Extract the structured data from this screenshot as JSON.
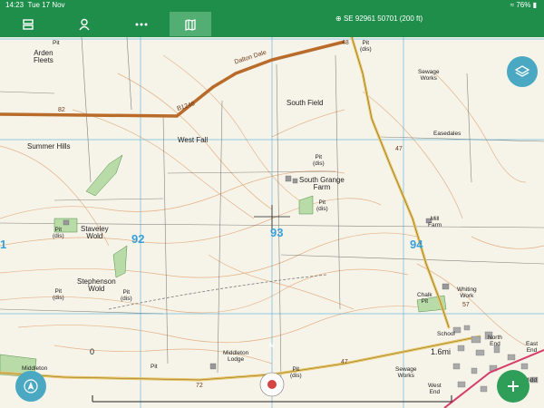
{
  "status_bar": {
    "time": "14:23",
    "date": "Tue 17 Nov",
    "battery": "76%"
  },
  "toolbar": {
    "grid_reference": "SE 92961 50701 (200 ft)"
  },
  "map": {
    "grid_numbers": [
      "92",
      "93",
      "94",
      "1"
    ],
    "place_labels": {
      "arden_fleets": "Arden\nFleets",
      "dalton_dale": "Dalton Dale",
      "south_field": "South Field",
      "summer_hills": "Summer Hills",
      "west_fall": "West Fall",
      "south_grange_farm": "South Grange\nFarm",
      "staveley_wold": "Staveley\nWold",
      "stephenson_wold": "Stephenson\nWold",
      "middleton_lodge": "Middleton\nLodge",
      "sewage_works_top": "Sewage\nWorks",
      "easedales": "Easedales",
      "mill_farm": "Mill\nFarm",
      "whiting_work": "Whiting\nWork",
      "chalk_pit": "Chalk\nPit",
      "school": "School",
      "north_end": "North\nEnd",
      "east_end": "East\nEnd",
      "sewage_works_bottom": "Sewage\nWorks",
      "west_end": "West\nEnd",
      "middleton": "Middleton",
      "midd": "Midd",
      "pit_dis": "Pit\n(dis)",
      "pit": "Pit"
    },
    "road_labels": {
      "b1246": "B1246",
      "a47": "47",
      "b48": "48",
      "r82": "82",
      "r72": "72",
      "r57": "57"
    },
    "scale": {
      "left": "0",
      "right": "1.6mi"
    },
    "compass": "N"
  },
  "colors": {
    "toolbar": "#1f8e4b",
    "accent": "#4aa8c2",
    "fab_add": "#2f9e58",
    "road_b": "#c98f3b",
    "road_a": "#e6c468",
    "grid": "#36a0dd",
    "contour": "#e0a070"
  }
}
